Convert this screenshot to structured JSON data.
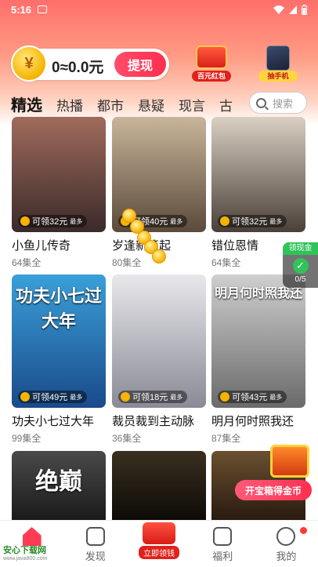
{
  "status": {
    "time": "5:16"
  },
  "wallet": {
    "coin_symbol": "¥",
    "amount": "0≈0.0元",
    "withdraw_label": "提现"
  },
  "promos": {
    "redpack_label": "百元红包",
    "phone_label": "抽手机"
  },
  "tabs": [
    "精选",
    "热播",
    "都市",
    "悬疑",
    "现言",
    "古"
  ],
  "search": {
    "placeholder": "搜索"
  },
  "cards": [
    {
      "title": "小鱼儿传奇",
      "eps": "64集全",
      "reward": "可领32元",
      "most": "最多",
      "colors": [
        "#a06b5c",
        "#3a2a2a"
      ]
    },
    {
      "title": "岁逢新篇起",
      "eps": "80集全",
      "reward": "可领40元",
      "most": "最多",
      "colors": [
        "#c8b59a",
        "#5a4a3a"
      ]
    },
    {
      "title": "错位恩情",
      "eps": "64集全",
      "reward": "可领32元",
      "most": "最多",
      "colors": [
        "#d9cfc2",
        "#4a4038"
      ]
    },
    {
      "title": "功夫小七过大年",
      "eps": "99集全",
      "reward": "可领49元",
      "most": "最多",
      "overlay": "功夫小七过大年",
      "colors": [
        "#3aa0d8",
        "#1a4a8a"
      ]
    },
    {
      "title": "裁员裁到主动脉",
      "eps": "36集全",
      "reward": "可领18元",
      "most": "最多",
      "overlay": "",
      "colors": [
        "#e8e8ec",
        "#8a8a96"
      ]
    },
    {
      "title": "明月何时照我还",
      "eps": "87集全",
      "reward": "可领43元",
      "most": "最多",
      "overlay": "明月何时照我还",
      "colors": [
        "#cfcfcf",
        "#6a6a6a"
      ]
    },
    {
      "title": "",
      "eps": "",
      "overlay": "绝巅",
      "colors": [
        "#4a4a4a",
        "#1a1a1a"
      ]
    },
    {
      "title": "",
      "eps": "",
      "colors": [
        "#3a3020",
        "#0d0a06"
      ]
    },
    {
      "title": "",
      "eps": "",
      "colors": [
        "#6a5030",
        "#2a1a10"
      ]
    }
  ],
  "claim_widget": {
    "label": "领现金",
    "progress": "0/5"
  },
  "chest_label": "开宝箱得金币",
  "nav": {
    "home": "",
    "discover": "发现",
    "earn": "立即领钱",
    "welfare": "福利",
    "mine": "我的"
  },
  "watermark": {
    "name": "安心下载网",
    "url": "www.java800.com"
  }
}
